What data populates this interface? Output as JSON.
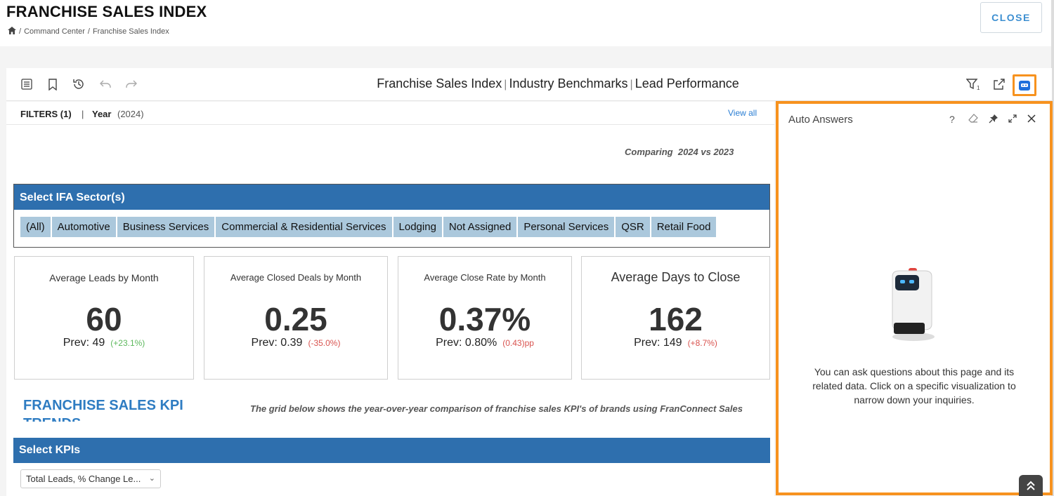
{
  "header": {
    "title": "FRANCHISE SALES INDEX",
    "breadcrumb": [
      "Command Center",
      "Franchise Sales Index"
    ],
    "close_label": "CLOSE"
  },
  "toolbar": {
    "title_parts": [
      "Franchise Sales Index",
      "Industry Benchmarks",
      "Lead Performance"
    ],
    "icons": [
      "table-of-contents-icon",
      "bookmark-icon",
      "history-icon",
      "undo-icon",
      "redo-icon",
      "filter-icon",
      "share-icon",
      "auto-answers-icon"
    ],
    "filter_badge": "1"
  },
  "filters": {
    "label": "FILTERS (1)",
    "separator": "|",
    "field": "Year",
    "value": "(2024)",
    "view_all": "View all"
  },
  "comparing": "Comparing  2024 vs 2023",
  "sector": {
    "heading": "Select IFA Sector(s)",
    "options": [
      "(All)",
      "Automotive",
      "Business Services",
      "Commercial & Residential Services",
      "Lodging",
      "Not Assigned",
      "Personal Services",
      "QSR",
      "Retail Food"
    ]
  },
  "kpis": [
    {
      "title": "Average Leads by Month",
      "value": "60",
      "prev": "Prev: 49",
      "change": "(+23.1%)",
      "color": "#5cb85c"
    },
    {
      "title": "Average Closed Deals by Month",
      "value": "0.25",
      "prev": "Prev: 0.39",
      "change": "(-35.0%)",
      "color": "#d9534f"
    },
    {
      "title": "Average Close Rate by Month",
      "value": "0.37%",
      "prev": "Prev: 0.80%",
      "change": "(0.43)pp",
      "color": "#d9534f"
    },
    {
      "title": "Average Days to Close",
      "value": "162",
      "prev": "Prev: 149",
      "change": "(+8.7%)",
      "color": "#d9534f"
    }
  ],
  "trends": {
    "title": "FRANCHISE SALES KPI TRENDS",
    "note": "The grid below shows the year-over-year comparison of franchise sales KPI's of brands using FranConnect Sales"
  },
  "select_kpis": {
    "heading": "Select KPIs",
    "dropdown_value": "Total Leads, % Change Le..."
  },
  "auto_answers": {
    "title": "Auto Answers",
    "controls": [
      "help-icon",
      "eraser-icon",
      "pin-icon",
      "expand-icon",
      "close-icon"
    ],
    "message": "You can ask questions about this page and its related data. Click on a specific visualization to narrow down your inquiries."
  },
  "colors": {
    "accent_orange": "#f7921e",
    "header_blue": "#2e6fae",
    "chip_blue": "#abc8dc",
    "link_blue": "#2a7ed3"
  }
}
